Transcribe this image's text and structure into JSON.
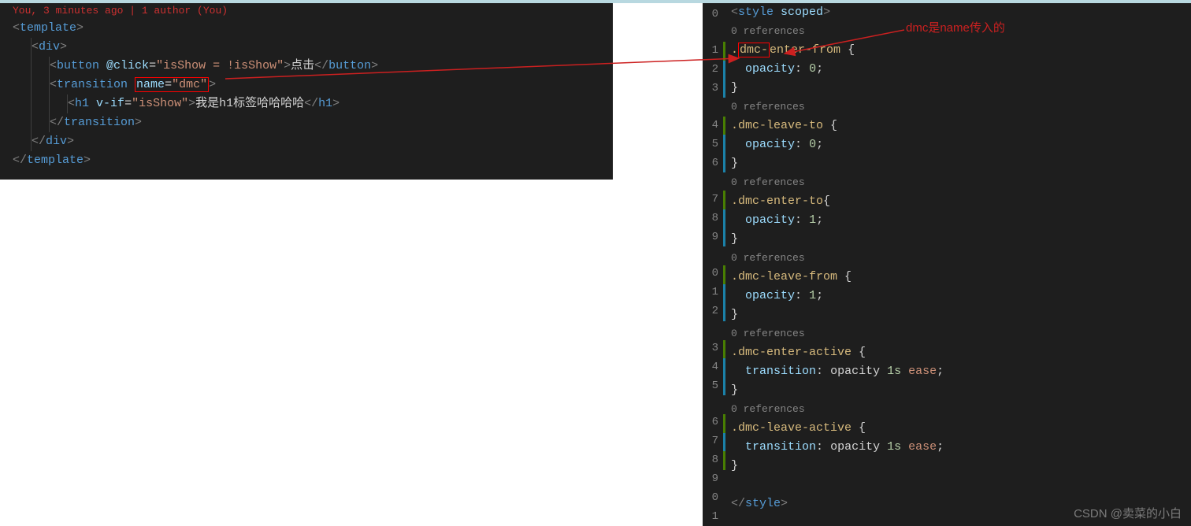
{
  "left": {
    "blame": "You, 3 minutes ago | 1 author (You)",
    "template_open": "template",
    "div": "div",
    "button": "button",
    "button_attr": "@click",
    "button_val": "\"isShow = !isShow\"",
    "button_text": "点击",
    "transition": "transition",
    "trans_attr": "name",
    "trans_val": "\"dmc\"",
    "h1": "h1",
    "h1_attr": "v-if",
    "h1_val": "\"isShow\"",
    "h1_text": "我是h1标签哈哈哈哈"
  },
  "right": {
    "line_nums": [
      "0",
      "",
      "1",
      "2",
      "3",
      "",
      "4",
      "5",
      "6",
      "",
      "7",
      "8",
      "9",
      "",
      "0",
      "1",
      "2",
      "",
      "3",
      "4",
      "5",
      "",
      "6",
      "7",
      "8",
      "9",
      "0",
      "1"
    ],
    "mods": [
      "",
      "",
      "g",
      "b",
      "b",
      "",
      "g",
      "b",
      "b",
      "",
      "g",
      "b",
      "b",
      "",
      "g",
      "b",
      "b",
      "",
      "g",
      "b",
      "b",
      "",
      "g",
      "b",
      "g",
      "",
      "",
      ""
    ],
    "style_open": "style",
    "style_attr": "scoped",
    "refs": "0 references",
    "sel1": ".dmc-enter-from",
    "sel1_pre": ".",
    "sel1_box": "dmc-",
    "sel1_post": "enter-from",
    "prop_opacity": "opacity",
    "v0": "0",
    "v1": "1",
    "sel2": ".dmc-leave-to",
    "sel3": ".dmc-enter-to",
    "sel4": ".dmc-leave-from",
    "sel5": ".dmc-enter-active",
    "sel6": ".dmc-leave-active",
    "prop_trans": "transition",
    "trans_val": "opacity",
    "trans_dur": "1s",
    "trans_ease": "ease"
  },
  "annotation": "dmc是name传入的",
  "watermark": "CSDN @卖菜的小白"
}
